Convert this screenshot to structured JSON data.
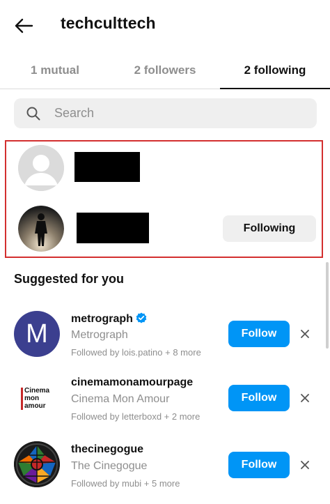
{
  "header": {
    "title": "techculttech",
    "back_icon": "arrow-left-icon"
  },
  "tabs": [
    {
      "label": "1 mutual",
      "active": false
    },
    {
      "label": "2 followers",
      "active": false
    },
    {
      "label": "2 following",
      "active": true
    }
  ],
  "search": {
    "placeholder": "Search",
    "value": "",
    "icon": "search-icon"
  },
  "following_list": [
    {
      "avatar": "default-avatar-placeholder",
      "username_redacted": true,
      "button": null
    },
    {
      "avatar": "silhouette-photo",
      "username_redacted": true,
      "button": "Following"
    }
  ],
  "suggested": {
    "title": "Suggested for you",
    "items": [
      {
        "username": "metrograph",
        "verified": true,
        "name": "Metrograph",
        "meta": "Followed by lois.patino + 8 more",
        "follow_label": "Follow",
        "avatar_letter": "M",
        "avatar_color": "#3b3f8f"
      },
      {
        "username": "cinemamonamourpage",
        "verified": false,
        "name": "Cinema Mon Amour",
        "meta": "Followed by letterboxd + 2 more",
        "follow_label": "Follow",
        "avatar_text": [
          "Cinema",
          "mon",
          "amour"
        ],
        "avatar_accent": "#c62828"
      },
      {
        "username": "thecinegogue",
        "verified": false,
        "name": "The Cinegogue",
        "meta": "Followed by mubi + 5 more",
        "follow_label": "Follow"
      }
    ]
  },
  "colors": {
    "follow_button": "#0095f6",
    "highlight_border": "#d32f2f",
    "verified": "#0095f6"
  }
}
